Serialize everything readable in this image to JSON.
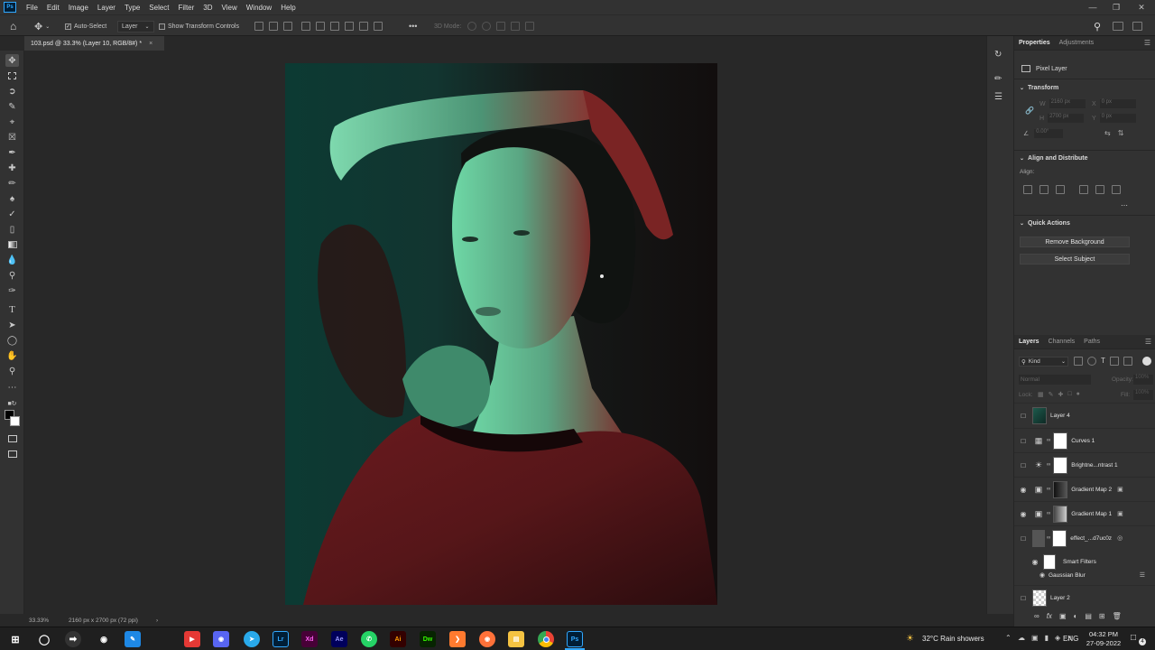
{
  "app": {
    "logo": "Ps"
  },
  "menu": [
    "File",
    "Edit",
    "Image",
    "Layer",
    "Type",
    "Select",
    "Filter",
    "3D",
    "View",
    "Window",
    "Help"
  ],
  "options": {
    "auto_select_label": "Auto-Select",
    "auto_select_value": "Layer",
    "show_transform_label": "Show Transform Controls",
    "mode_3d_label": "3D Mode:",
    "more": "•••"
  },
  "document": {
    "tab_title": "103.psd @ 33.3% (Layer 10, RGB/8#) *",
    "close": "×"
  },
  "status": {
    "zoom": "33.33%",
    "dimensions": "2160 px x 2700 px (72 ppi)",
    "arrow": "›"
  },
  "properties": {
    "tabs": [
      "Properties",
      "Adjustments"
    ],
    "layer_type": "Pixel Layer",
    "transform_title": "Transform",
    "w_label": "W",
    "w_value": "2160 px",
    "h_label": "H",
    "h_value": "2700 px",
    "x_label": "X",
    "x_value": "0 px",
    "y_label": "Y",
    "y_value": "0 px",
    "angle_value": "0.00°",
    "align_title": "Align and Distribute",
    "align_label": "Align:",
    "quick_actions_title": "Quick Actions",
    "remove_bg": "Remove Background",
    "select_subject": "Select Subject"
  },
  "layers_panel": {
    "tabs": [
      "Layers",
      "Channels",
      "Paths"
    ],
    "kind_label": "Kind",
    "blend_mode": "Normal",
    "opacity_label": "Opacity:",
    "opacity_value": "100%",
    "lock_label": "Lock:",
    "fill_label": "Fill:",
    "fill_value": "100%",
    "layers": [
      {
        "name": "Layer 4",
        "visible": false
      },
      {
        "name": "Curves 1",
        "visible": false
      },
      {
        "name": "Brightne...ntrast 1",
        "visible": false
      },
      {
        "name": "Gradient Map 2",
        "visible": true
      },
      {
        "name": "Gradient Map 1",
        "visible": true
      },
      {
        "name": "effect_...d7uc0z",
        "visible": false
      },
      {
        "name": "Smart Filters",
        "visible": true
      },
      {
        "name": "Gaussian Blur",
        "visible": true
      },
      {
        "name": "Layer 2",
        "visible": false
      }
    ]
  },
  "taskbar": {
    "weather": "32°C  Rain showers",
    "lang": "ENG",
    "time": "04:32 PM",
    "date": "27-09-2022",
    "notification_count": "4",
    "apps": [
      "Lr",
      "Xd",
      "Ae",
      "Ai",
      "Dw",
      "Ps"
    ]
  },
  "colors": {
    "accent": "#31a8ff",
    "panel": "#323232",
    "canvas": "#282828"
  }
}
